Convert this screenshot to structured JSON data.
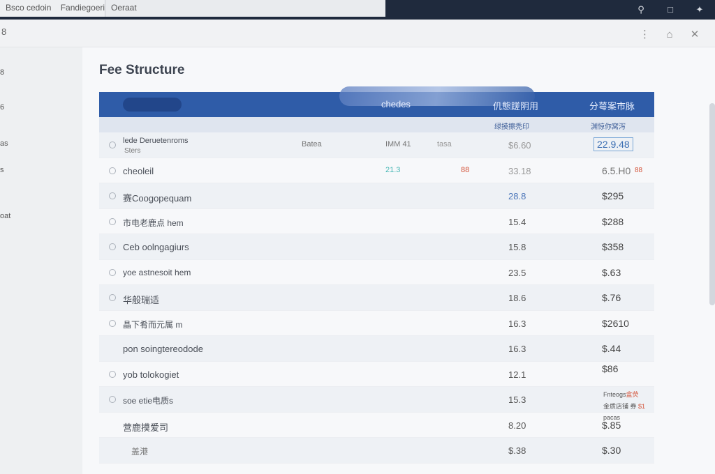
{
  "tabs": [
    {
      "label": "Bsco cedoin"
    },
    {
      "label": "Fandiegoeri"
    },
    {
      "label": "Oeraat"
    }
  ],
  "window": {
    "left_mark": "8",
    "controls": [
      "⋮",
      "⌂",
      "✕"
    ]
  },
  "sidebar": {
    "items": [
      "8",
      "6",
      "as",
      "s",
      "oat"
    ]
  },
  "page": {
    "title": "Fee Structure"
  },
  "table": {
    "headers": {
      "h1": "chedes",
      "h2": "仉態蹉阴用",
      "h3": "分萼案市脉"
    },
    "subheaders": {
      "s1": "绿摸擦秃印",
      "s2": "渊惊你窝泻"
    },
    "rows": [
      {
        "name": "lede Deruetenroms",
        "sub": "Sters",
        "c1": "Batea",
        "c2": "IMM 41",
        "c3": "tasa",
        "val": "$6.60",
        "price": "22.9.48",
        "tag": ""
      },
      {
        "name": "cheoleil",
        "sub": "",
        "c1": "",
        "c2": "21.3",
        "c3": "88",
        "val": "33.18",
        "price": "6.5.H0",
        "tag": "88"
      },
      {
        "name": "赛Coogopequam",
        "sub": "",
        "c1": "",
        "c2": "",
        "c3": "",
        "val": "28.8",
        "price": "$295",
        "tag": ""
      },
      {
        "name": "市电老鹿点 hem",
        "sub": "",
        "c1": "",
        "c2": "",
        "c3": "",
        "val": "15.4",
        "price": "$288",
        "tag": ""
      },
      {
        "name": "Ceb oolngagiurs",
        "sub": "",
        "c1": "",
        "c2": "",
        "c3": "",
        "val": "15.8",
        "price": "$358",
        "tag": ""
      },
      {
        "name": "yoe astnesoit hem",
        "sub": "",
        "c1": "",
        "c2": "",
        "c3": "",
        "val": "23.5",
        "price": "$.63",
        "tag": ""
      },
      {
        "name": "华般瑞适",
        "sub": "",
        "c1": "",
        "c2": "",
        "c3": "",
        "val": "18.6",
        "price": "$.76",
        "tag": ""
      },
      {
        "name": "晶下肴而元属 m",
        "sub": "",
        "c1": "",
        "c2": "",
        "c3": "",
        "val": "16.3",
        "price": "$2610",
        "tag": ""
      },
      {
        "name": "pon soingtereodode",
        "sub": "",
        "c1": "",
        "c2": "",
        "c3": "",
        "val": "16.3",
        "price": "$.44",
        "tag": ""
      },
      {
        "name": "yob tolokogiet",
        "sub": "",
        "c1": "",
        "c2": "",
        "c3": "",
        "val": "12.1",
        "price": "$86",
        "tag": ""
      },
      {
        "name": "soe etie电质s",
        "sub": "",
        "c1": "",
        "c2": "",
        "c3": "",
        "val": "15.3",
        "price": "",
        "tag": ""
      },
      {
        "name": "营鹿摸爱司",
        "sub": "",
        "c1": "",
        "c2": "",
        "c3": "",
        "val": "8.20",
        "price": "$.85",
        "tag": ""
      },
      {
        "name": "盖港",
        "sub": "",
        "c1": "",
        "c2": "",
        "c3": "",
        "val": "$.38",
        "price": "$.30",
        "tag": ""
      }
    ],
    "notes": {
      "n1": "Fnteogs",
      "n1_red": "盒荧",
      "n2": "金质店铺 券",
      "n2_red": "$1",
      "n3": "pacas"
    }
  },
  "colors": {
    "header_blue": "#2f5ca8",
    "accent_red": "#d4543a",
    "tab_bar": "#1f2a3d"
  }
}
